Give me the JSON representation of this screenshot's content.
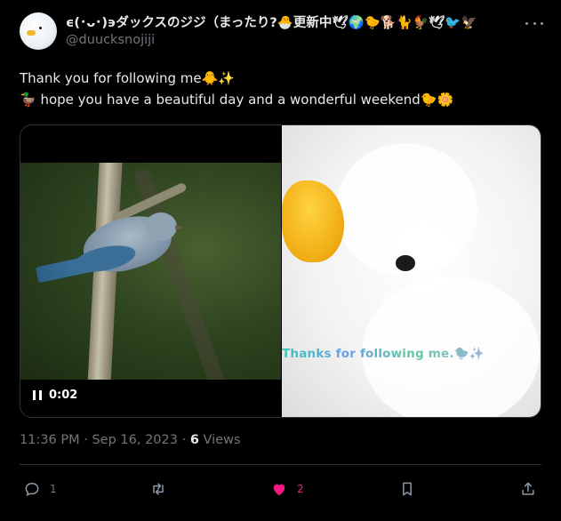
{
  "user": {
    "display_name": "ϵ(･ᴗ･)϶ダックスのジジ（まったり?🐣更新中🕊🌍🐤🐕🐈🐓🕊🐦🦅",
    "handle": "@duucksnojiji"
  },
  "tweet": {
    "line1": "Thank you for following me🐥✨",
    "line2": "🦆 hope you have a beautiful day and a wonderful weekend🐤🌼"
  },
  "media": {
    "video_time": "0:02",
    "image_caption": "Thanks for following me.🐤✨"
  },
  "meta": {
    "timestamp": "11:36 PM · Sep 16, 2023 · ",
    "views_count": "6",
    "views_label": " Views"
  },
  "actions": {
    "reply_count": "1",
    "retweet_count": "",
    "like_count": "2"
  },
  "colors": {
    "like": "#f91880",
    "muted": "#71767b",
    "text": "#e7e9ea",
    "background": "#000000"
  }
}
